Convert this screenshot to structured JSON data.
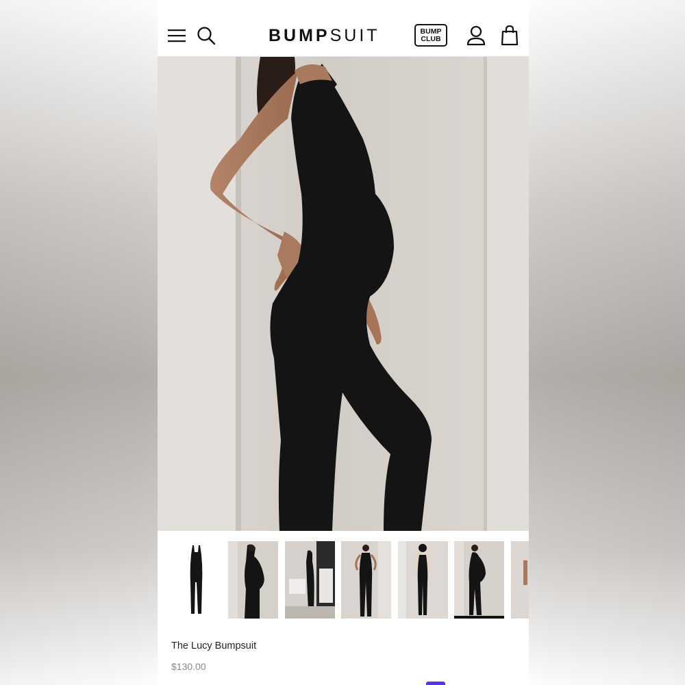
{
  "header": {
    "logo_bold": "BUMP",
    "logo_light": "SUIT",
    "club_line1": "BUMP",
    "club_line2": "CLUB",
    "menu_icon": "hamburger-icon",
    "search_icon": "search-icon",
    "account_icon": "user-icon",
    "cart_icon": "shopping-bag-icon"
  },
  "product": {
    "title": "The Lucy Bumpsuit",
    "price": "$130.00"
  },
  "thumbnails": [
    {
      "label": "flat-lay"
    },
    {
      "label": "pregnant-side"
    },
    {
      "label": "mirror-room"
    },
    {
      "label": "front-full"
    },
    {
      "label": "with-cardigan"
    },
    {
      "label": "side-pose",
      "active": true
    },
    {
      "label": "partial"
    }
  ],
  "colors": {
    "accent": "#111111",
    "price": "#8a8a8a",
    "pay": "#5a31f4"
  }
}
